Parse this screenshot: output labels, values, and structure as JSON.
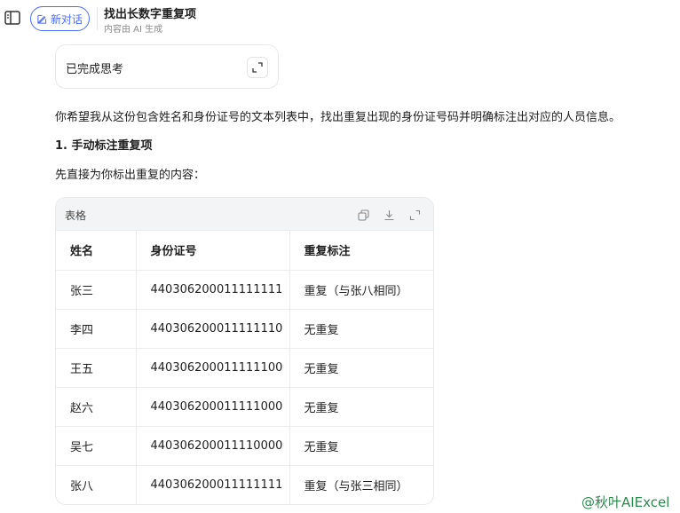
{
  "header": {
    "new_chat_label": "新对话",
    "title": "找出长数字重复项",
    "subtitle": "内容由 AI 生成"
  },
  "thinking": {
    "label": "已完成思考"
  },
  "message": {
    "intro": "你希望我从这份包含姓名和身份证号的文本列表中，找出重复出现的身份证号码并明确标注出对应的人员信息。",
    "heading": "1. 手动标注重复项",
    "lead": "先直接为你标出重复的内容："
  },
  "table": {
    "title": "表格",
    "headers": [
      "姓名",
      "身份证号",
      "重复标注"
    ],
    "rows": [
      [
        "张三",
        "440306200011111111",
        "重复（与张八相同）"
      ],
      [
        "李四",
        "440306200011111110",
        "无重复"
      ],
      [
        "王五",
        "440306200011111100",
        "无重复"
      ],
      [
        "赵六",
        "440306200011111000",
        "无重复"
      ],
      [
        "吴七",
        "440306200011110000",
        "无重复"
      ],
      [
        "张八",
        "440306200011111111",
        "重复（与张三相同）"
      ]
    ]
  },
  "watermark": "@秋叶AIExcel",
  "colors": {
    "accent": "#4d6bfe",
    "watermark": "#2d8a4e"
  }
}
